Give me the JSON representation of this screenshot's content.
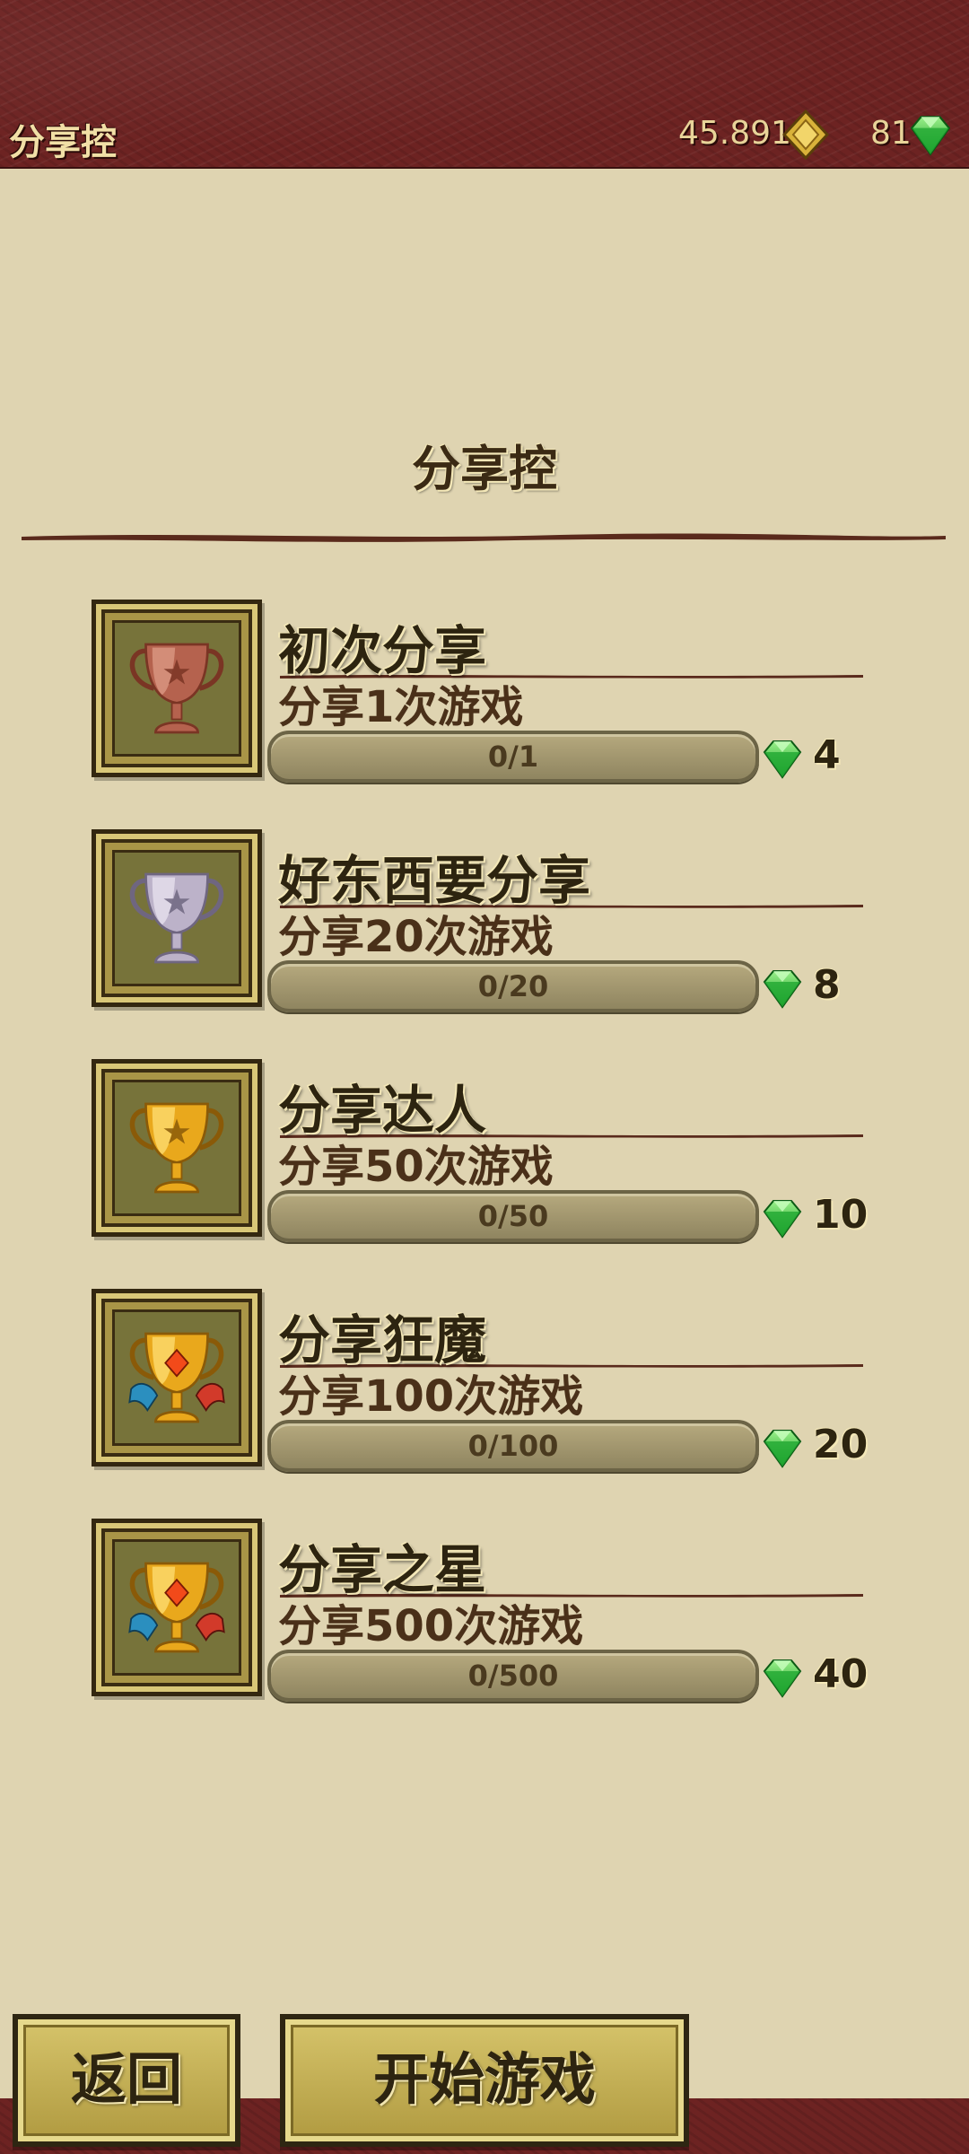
{
  "header": {
    "title": "分享控",
    "gold": "45.891",
    "gems": "81"
  },
  "page": {
    "title": "分享控"
  },
  "achievements": [
    {
      "name": "初次分享",
      "desc": "分享1次游戏",
      "progress_text": "0/1",
      "progress": 0,
      "reward": "4",
      "trophy": "bronze-trophy-icon"
    },
    {
      "name": "好东西要分享",
      "desc": "分享20次游戏",
      "progress_text": "0/20",
      "progress": 0,
      "reward": "8",
      "trophy": "silver-trophy-icon"
    },
    {
      "name": "分享达人",
      "desc": "分享50次游戏",
      "progress_text": "0/50",
      "progress": 0,
      "reward": "10",
      "trophy": "gold-trophy-icon"
    },
    {
      "name": "分享狂魔",
      "desc": "分享100次游戏",
      "progress_text": "0/100",
      "progress": 0,
      "reward": "20",
      "trophy": "gold-ribbon-trophy-icon"
    },
    {
      "name": "分享之星",
      "desc": "分享500次游戏",
      "progress_text": "0/500",
      "progress": 0,
      "reward": "40",
      "trophy": "gold-ribbon-trophy-icon"
    }
  ],
  "buttons": {
    "back": "返回",
    "start": "开始游戏"
  },
  "colors": {
    "header_bg": "#6d2322",
    "page_bg": "#dfd4b1",
    "gem_green": "#2fbf3a",
    "button_gold": "#c9b656"
  }
}
